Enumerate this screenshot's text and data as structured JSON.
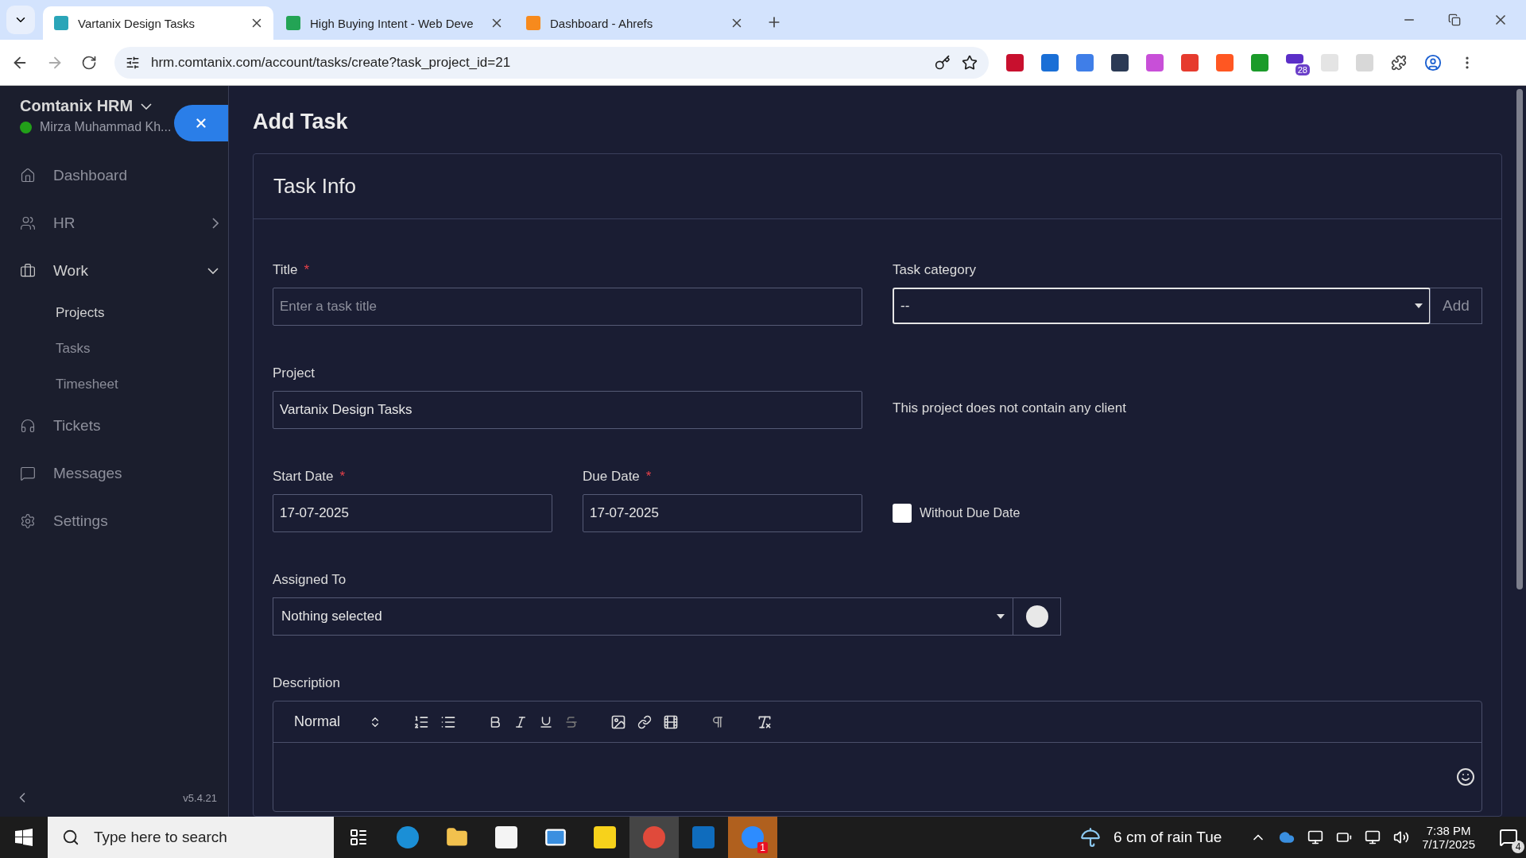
{
  "browser": {
    "tabs": [
      {
        "title": "Vartanix Design Tasks",
        "selected": true
      },
      {
        "title": "High Buying Intent - Web Deve",
        "selected": false
      },
      {
        "title": "Dashboard - Ahrefs",
        "selected": false
      }
    ],
    "url": "hrm.comtanix.com/account/tasks/create?task_project_id=21",
    "extension_badge": "28"
  },
  "sidebar": {
    "brand": "Comtanix HRM",
    "user": "Mirza Muhammad Kh...",
    "online": true,
    "items": [
      {
        "label": "Dashboard",
        "kind": "link",
        "expanded": false
      },
      {
        "label": "HR",
        "kind": "group",
        "expanded": false
      },
      {
        "label": "Work",
        "kind": "group",
        "expanded": true,
        "children": [
          {
            "label": "Projects",
            "selected": true
          },
          {
            "label": "Tasks",
            "selected": false
          },
          {
            "label": "Timesheet",
            "selected": false
          }
        ]
      },
      {
        "label": "Tickets",
        "kind": "link",
        "expanded": false
      },
      {
        "label": "Messages",
        "kind": "link",
        "expanded": false
      },
      {
        "label": "Settings",
        "kind": "link",
        "expanded": false
      }
    ],
    "version": "v5.4.21"
  },
  "page_title": "Add Task",
  "card_title": "Task Info",
  "form": {
    "title": {
      "label": "Title",
      "required_mark": "*",
      "placeholder": "Enter a task title"
    },
    "task_category": {
      "label": "Task category",
      "value": "--",
      "button": "Add"
    },
    "project": {
      "label": "Project",
      "value": "Vartanix Design Tasks"
    },
    "client_note": "This project does not contain any client",
    "start_date": {
      "label": "Start Date",
      "required_mark": "*",
      "value": "17-07-2025"
    },
    "due_date": {
      "label": "Due Date",
      "required_mark": "*",
      "value": "17-07-2025"
    },
    "without_due_date": {
      "label": "Without Due Date",
      "checked": false
    },
    "assigned_to": {
      "label": "Assigned To",
      "value": "Nothing selected"
    },
    "description": {
      "label": "Description",
      "format": "Normal"
    }
  },
  "taskbar": {
    "search_placeholder": "Type here to search",
    "zoom_badge": "1",
    "weather": "6 cm of rain Tue",
    "time": "7:38 PM",
    "date": "7/17/2025",
    "notifications": "4"
  }
}
